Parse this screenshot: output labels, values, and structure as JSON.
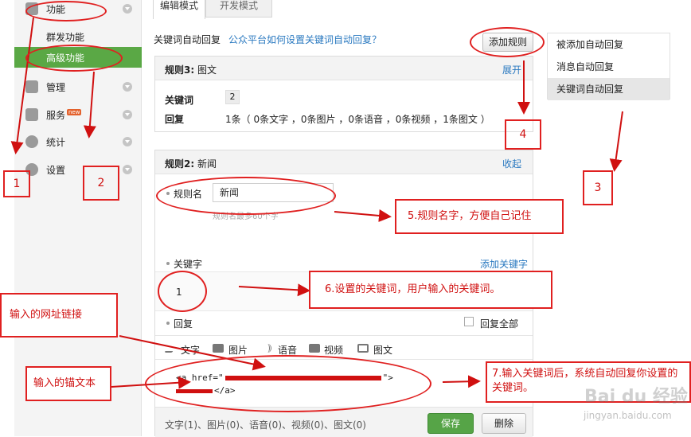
{
  "tabs": [
    {
      "label": "编辑模式"
    },
    {
      "label": "开发模式"
    }
  ],
  "sidebar": {
    "function_label": "功能",
    "sub_items": [
      {
        "label": "群发功能"
      },
      {
        "label": "高级功能"
      }
    ],
    "items": [
      {
        "label": "管理",
        "icon": "manage-icon"
      },
      {
        "label": "服务",
        "icon": "service-icon",
        "badge": "new"
      },
      {
        "label": "统计",
        "icon": "stats-icon"
      },
      {
        "label": "设置",
        "icon": "settings-icon"
      }
    ]
  },
  "header": {
    "title": "关键词自动回复",
    "help_link": "公众平台如何设置关键词自动回复？",
    "add_rule": "添加规则"
  },
  "right_list": [
    {
      "label": "被添加自动回复"
    },
    {
      "label": "消息自动回复"
    },
    {
      "label": "关键词自动回复",
      "active": true
    }
  ],
  "rule3": {
    "title_prefix": "规则3:",
    "title_name": "图文",
    "toggle": "展开",
    "keyword_label": "关键词",
    "keyword_value": "2",
    "reply_label": "回复",
    "reply_summary": "1条（ 0条文字 ，0条图片 ，0条语音 ，0条视频 ，1条图文 ）"
  },
  "rule2": {
    "title_prefix": "规则2:",
    "title_name": "新闻",
    "toggle": "收起",
    "name_label": "规则名",
    "name_value": "新闻",
    "name_hint": "规则名最多60个字",
    "keyword_label": "关键字",
    "add_keyword": "添加关键字",
    "keyword_value": "1",
    "reply_label": "回复",
    "reply_all": "回复全部",
    "toolbar": [
      {
        "label": "文字"
      },
      {
        "label": "图片"
      },
      {
        "label": "语音"
      },
      {
        "label": "视频"
      },
      {
        "label": "图文"
      }
    ],
    "reply_text_line1_a": "<a href=\"",
    "reply_text_line1_b": "\">",
    "reply_text_line2_a": "",
    "reply_text_line2_b": "</a>",
    "footer_counts": "文字(1)、图片(0)、语音(0)、视频(0)、图文(0)",
    "save": "保存",
    "delete": "删除"
  },
  "annotations": {
    "n1": "1",
    "n2": "2",
    "n3": "3",
    "n4": "4",
    "a5": "5.规则名字，方便自己记住",
    "a6": "6.设置的关键词，用户输入的关键词。",
    "url_note": "输入的网址链接",
    "anchor_note": "输入的锚文本",
    "a7": "7.输入关键词后，系统自动回复你设置的关键词。"
  },
  "watermark": {
    "text": "Bai du 经验",
    "url": "jingyan.baidu.com"
  },
  "colors": {
    "accent_green": "#5aa845",
    "link_blue": "#2a79c0",
    "annotation_red": "#e02020"
  }
}
